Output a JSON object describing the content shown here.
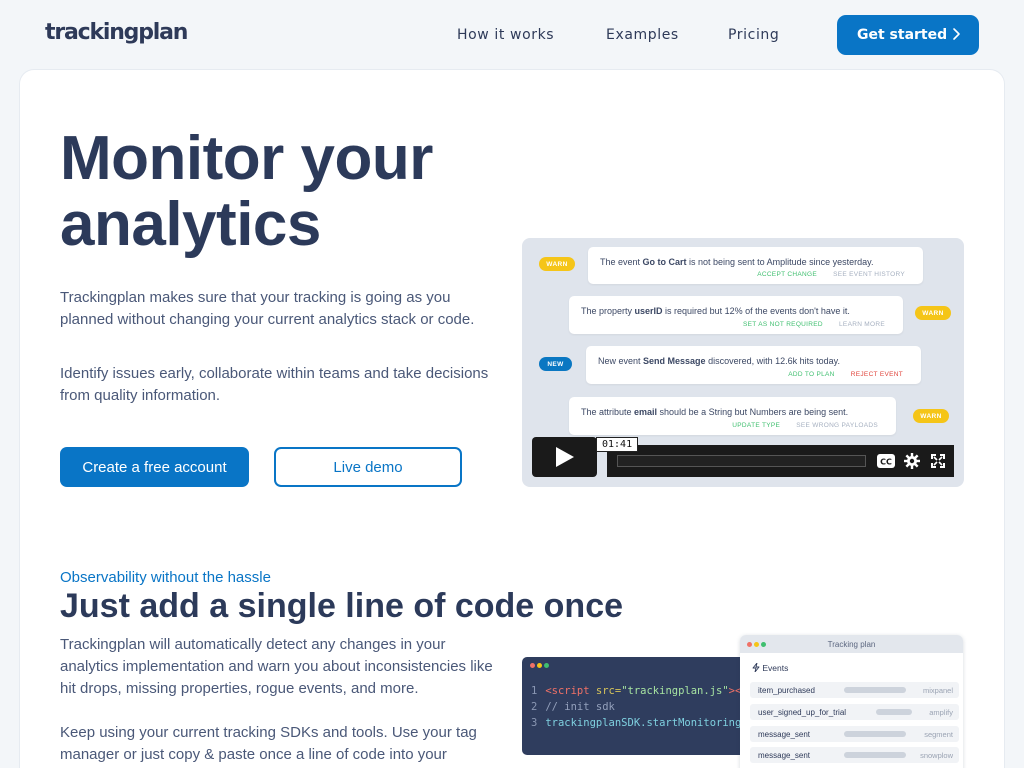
{
  "header": {
    "logo": "trackingplan",
    "nav": [
      "How it works",
      "Examples",
      "Pricing"
    ],
    "cta": "Get started",
    "cta_icon": "chevron-right-icon"
  },
  "hero": {
    "title": "Monitor your analytics",
    "paragraph1": "Trackingplan makes sure that your tracking is going as you planned without changing your current analytics stack or code.",
    "paragraph2": "Identify issues early, collaborate within teams and take decisions from quality information.",
    "primary_button": "Create a free account",
    "secondary_button": "Live demo"
  },
  "video": {
    "timecode": "01:41",
    "controls": [
      "play-icon",
      "closed-captions-icon",
      "settings-gear-icon",
      "fullscreen-icon"
    ],
    "notifications": [
      {
        "tag": "WARN",
        "pre": "The event ",
        "bold": "Go to Cart",
        "post": " is not being sent to Amplitude since yesterday.",
        "actions": [
          "ACCEPT CHANGE",
          "SEE EVENT HISTORY"
        ]
      },
      {
        "tag": "WARN",
        "pre": "The property ",
        "bold": "userID",
        "post": " is required but 12% of the events don't have it.",
        "actions": [
          "SET AS NOT REQUIRED",
          "LEARN MORE"
        ]
      },
      {
        "tag": "NEW",
        "pre": "New event ",
        "bold": "Send Message",
        "post": " discovered, with 12.6k hits today.",
        "actions": [
          "ADD TO PLAN",
          "REJECT EVENT"
        ]
      },
      {
        "tag": "WARN",
        "pre": "The attribute ",
        "bold": "email",
        "post": " should be a String but Numbers are being sent.",
        "actions": [
          "UPDATE TYPE",
          "SEE WRONG PAYLOADS"
        ]
      }
    ]
  },
  "section2": {
    "eyebrow": "Observability without the hassle",
    "title": "Just add a single line of code once",
    "paragraph1": "Trackingplan will automatically detect any changes in your analytics implementation and warn you about inconsistencies like hit drops, missing properties, rogue events, and more.",
    "paragraph2": "Keep using your current tracking SDKs and tools. Use your tag manager or just copy & paste once a line of code into your"
  },
  "code": {
    "lines": [
      {
        "n": "1",
        "tag_open": "<script",
        "attr": " src=",
        "str": "\"trackingplan.js\"",
        "tag_close": "></s"
      },
      {
        "n": "2",
        "comment": "// init sdk"
      },
      {
        "n": "3",
        "fn": "trackingplanSDK.startMonitoring()"
      }
    ],
    "window_dot_colors": [
      "#f07167",
      "#f5c518",
      "#3fbf6f"
    ]
  },
  "tracking_plan": {
    "title": "Tracking plan",
    "events_label": "Events",
    "events_icon": "lightning-icon",
    "rows": [
      {
        "event": "item_purchased",
        "destination": "mixpanel"
      },
      {
        "event": "user_signed_up_for_trial",
        "destination": "amplify"
      },
      {
        "event": "message_sent",
        "destination": "segment"
      },
      {
        "event": "message_sent",
        "destination": "snowplow"
      }
    ]
  },
  "colors": {
    "accent": "#0975c6",
    "text": "#2c3a5a",
    "warn": "#f5c518",
    "new": "#0a77c2",
    "success": "#3fbf6f",
    "danger": "#e0453c"
  }
}
